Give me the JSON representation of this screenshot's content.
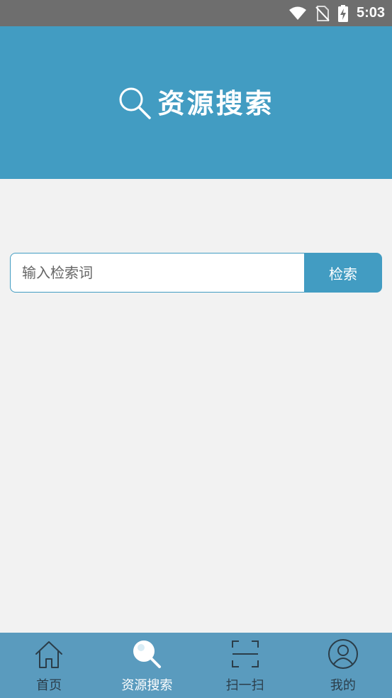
{
  "status_bar": {
    "time": "5:03"
  },
  "header": {
    "title": "资源搜索",
    "icon": "search-icon"
  },
  "search": {
    "placeholder": "输入检索词",
    "value": "",
    "button_label": "检索"
  },
  "bottom_nav": {
    "items": [
      {
        "label": "首页",
        "icon": "home-icon",
        "active": false
      },
      {
        "label": "资源搜索",
        "icon": "search-icon",
        "active": true
      },
      {
        "label": "扫一扫",
        "icon": "scan-icon",
        "active": false
      },
      {
        "label": "我的",
        "icon": "profile-icon",
        "active": false
      }
    ]
  },
  "colors": {
    "primary": "#429cc2",
    "nav_background": "#5a9bbe",
    "page_background": "#f2f2f2",
    "status_bar": "#6e6e6e"
  }
}
